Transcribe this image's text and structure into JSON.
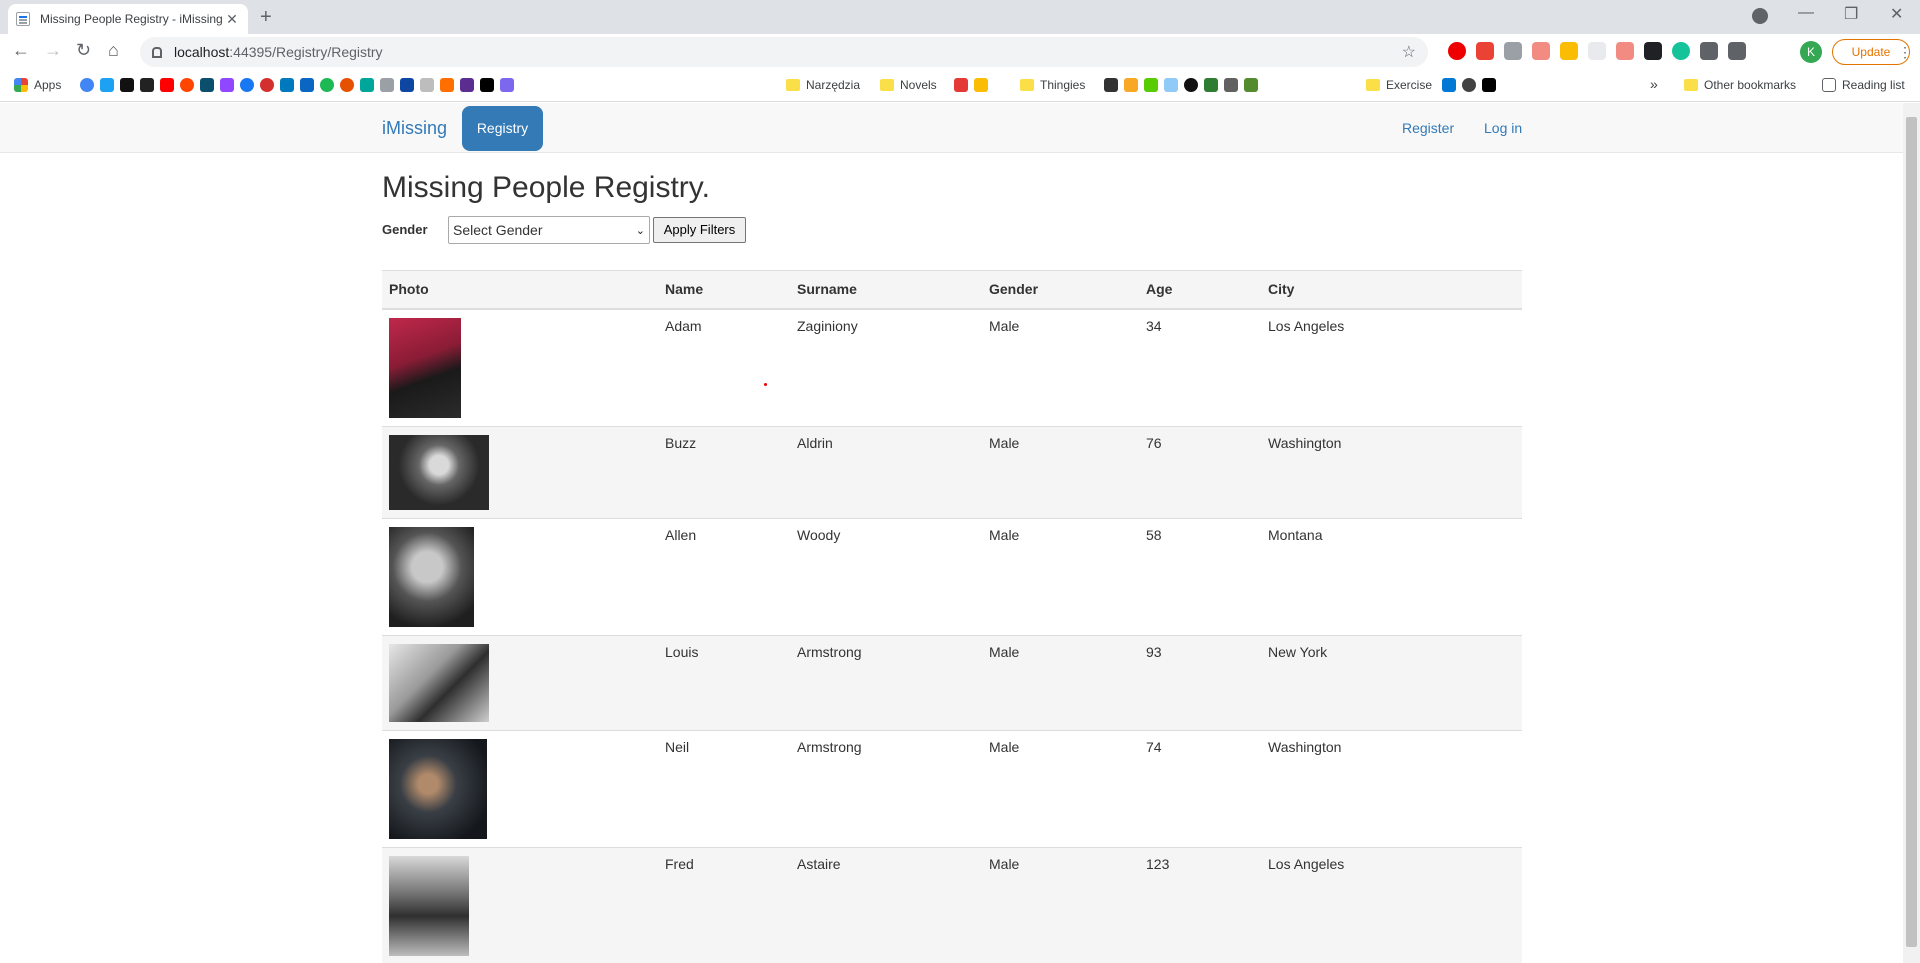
{
  "browser": {
    "tab_title": "Missing People Registry - iMissing",
    "url_host": "localhost",
    "url_path": ":44395/Registry/Registry",
    "update_label": "Update",
    "profile_initial": "K"
  },
  "bookmarks": {
    "apps": "Apps",
    "narzedzia": "Narzędzia",
    "novels": "Novels",
    "thingies": "Thingies",
    "exercise": "Exercise",
    "other": "Other bookmarks",
    "reading_list": "Reading list",
    "overflow": "»"
  },
  "nav": {
    "brand": "iMissing",
    "registry": "Registry",
    "register": "Register",
    "login": "Log in"
  },
  "page": {
    "title": "Missing People Registry.",
    "gender_label": "Gender",
    "gender_select": "Select Gender",
    "apply_button": "Apply Filters"
  },
  "table": {
    "headers": [
      "Photo",
      "Name",
      "Surname",
      "Gender",
      "Age",
      "City"
    ],
    "rows": [
      {
        "name": "Adam",
        "surname": "Zaginiony",
        "gender": "Male",
        "age": "34",
        "city": "Los Angeles"
      },
      {
        "name": "Buzz",
        "surname": "Aldrin",
        "gender": "Male",
        "age": "76",
        "city": "Washington"
      },
      {
        "name": "Allen",
        "surname": "Woody",
        "gender": "Male",
        "age": "58",
        "city": "Montana"
      },
      {
        "name": "Louis",
        "surname": "Armstrong",
        "gender": "Male",
        "age": "93",
        "city": "New York"
      },
      {
        "name": "Neil",
        "surname": "Armstrong",
        "gender": "Male",
        "age": "74",
        "city": "Washington"
      },
      {
        "name": "Fred",
        "surname": "Astaire",
        "gender": "Male",
        "age": "123",
        "city": "Los Angeles"
      }
    ]
  },
  "colors": {
    "link": "#337ab7",
    "navbar_bg": "#f8f8f8",
    "update_orange": "#e37400"
  }
}
